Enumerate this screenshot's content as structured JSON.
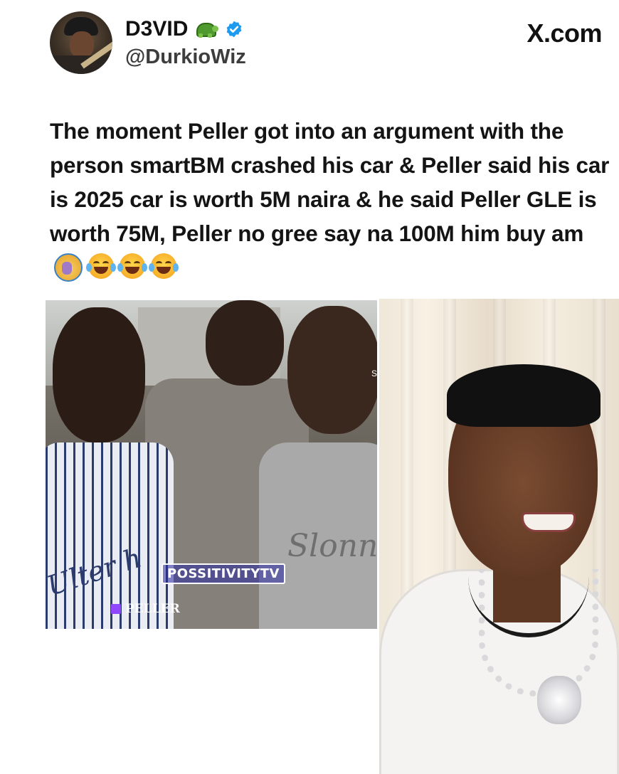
{
  "header": {
    "display_name": "D3VID",
    "handle": "@DurkioWiz",
    "site": "X.com",
    "verified": true,
    "name_emoji": "turtle-icon"
  },
  "tweet": {
    "text": "The moment Peller got into an argument with the person smartBM crashed his car & Peller said his car is 2025 car is worth 5M naira & he said Peller GLE is worth 75M, Peller no gree say na 100M him buy am",
    "emojis": [
      "face-palm-icon",
      "joy-icon",
      "joy-icon",
      "joy-icon"
    ]
  },
  "media": {
    "left": {
      "watermark": "POSSITIVITYTV",
      "tag": "PELLER",
      "shirt_text": "Slonn",
      "jersey_text": "Ulter h",
      "edge_text": "S"
    },
    "right": {}
  },
  "colors": {
    "verified": "#1d9bf0",
    "text": "#141414",
    "handle": "#3d3d3d",
    "watermark_bg": "#2828a0"
  }
}
